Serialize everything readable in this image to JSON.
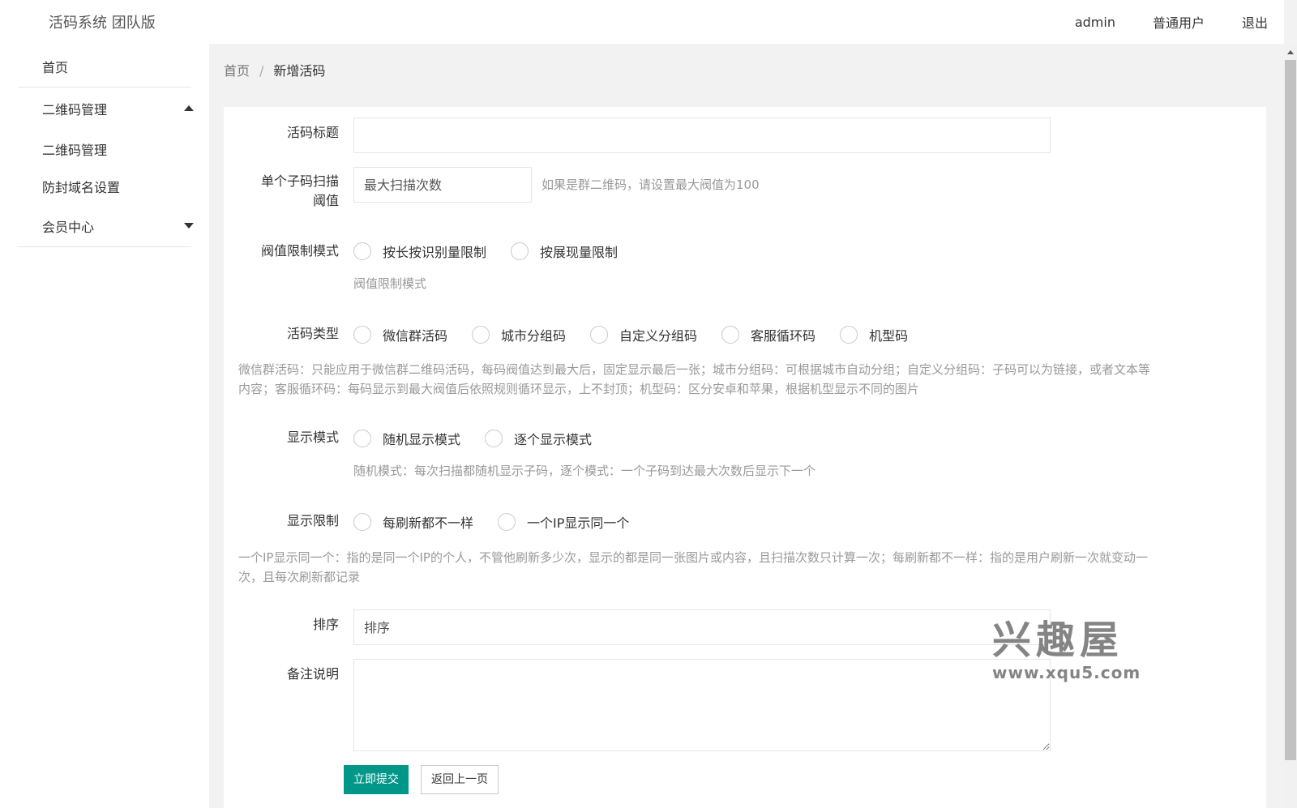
{
  "header": {
    "logo": "活码系统 团队版",
    "user": "admin",
    "role": "普通用户",
    "logout": "退出"
  },
  "sidebar": {
    "items": [
      {
        "label": "首页"
      },
      {
        "label": "二维码管理",
        "expanded": true
      },
      {
        "label": "二维码管理"
      },
      {
        "label": "防封域名设置"
      },
      {
        "label": "会员中心",
        "expanded": false
      }
    ]
  },
  "breadcrumb": {
    "home": "首页",
    "separator": "/",
    "current": "新增活码"
  },
  "form": {
    "title_label": "活码标题",
    "title_value": "",
    "threshold_label_1": "单个子码扫描",
    "threshold_label_2": "阈值",
    "threshold_placeholder": "最大扫描次数",
    "threshold_hint": "如果是群二维码，请设置最大阀值为100",
    "limit_mode_label": "阀值限制模式",
    "limit_mode_options": [
      "按长按识别量限制",
      "按展现量限制"
    ],
    "limit_mode_hint": "阀值限制模式",
    "type_label": "活码类型",
    "type_options": [
      "微信群活码",
      "城市分组码",
      "自定义分组码",
      "客服循环码",
      "机型码"
    ],
    "type_hint_1": "微信群活码：只能应用于微信群二维码活码，每码阀值达到最大后，固定显示最后一张；城市分组码：可根据城市自动分组；自定义分组码：子码可以为链接，或者文本等",
    "type_hint_2": "内容；客服循环码：每码显示到最大阀值后依照规则循环显示，上不封顶；机型码：区分安卓和苹果，根据机型显示不同的图片",
    "display_mode_label": "显示模式",
    "display_mode_options": [
      "随机显示模式",
      "逐个显示模式"
    ],
    "display_mode_hint": "随机模式：每次扫描都随机显示子码，逐个模式：一个子码到达最大次数后显示下一个",
    "display_limit_label": "显示限制",
    "display_limit_options": [
      "每刷新都不一样",
      "一个IP显示同一个"
    ],
    "display_limit_hint_1": "一个IP显示同一个：指的是同一个IP的个人，不管他刷新多少次，显示的都是同一张图片或内容，且扫描次数只计算一次；每刷新都不一样：指的是用户刷新一次就变动一",
    "display_limit_hint_2": "次，且每次刷新都记录",
    "sort_label": "排序",
    "sort_placeholder": "排序",
    "remark_label": "备注说明",
    "remark_value": "",
    "submit": "立即提交",
    "back": "返回上一页"
  },
  "watermark": {
    "big": "兴趣屋",
    "small": "www.xqu5.com"
  },
  "colors": {
    "primary": "#009688",
    "background": "#f2f2f2"
  }
}
